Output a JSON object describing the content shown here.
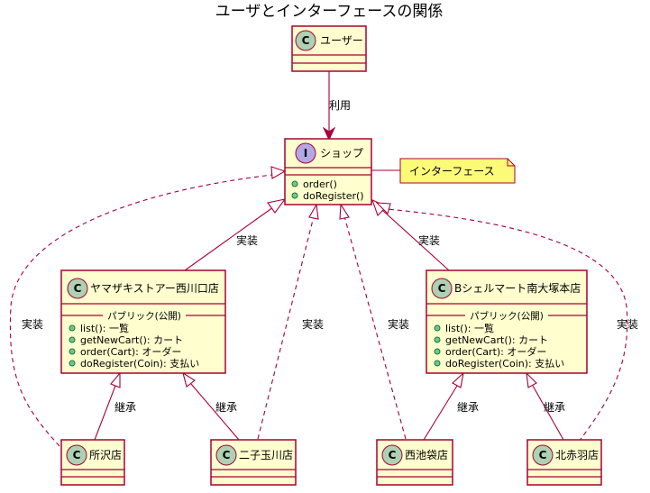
{
  "diagram": {
    "title": "ユーザとインターフェースの関係",
    "classes": {
      "user": {
        "stereotype": "C",
        "name": "ユーザー"
      },
      "shop": {
        "stereotype": "I",
        "name": "ショップ",
        "methods": [
          "order()",
          "doRegister()"
        ]
      },
      "yamazaki": {
        "stereotype": "C",
        "name": "ヤマザキストアー西川口店",
        "section": "パブリック(公開)",
        "methods": [
          "list(): 一覧",
          "getNewCart(): カート",
          "order(Cart): オーダー",
          "doRegister(Coin): 支払い"
        ]
      },
      "bshell": {
        "stereotype": "C",
        "name": "Bシェルマート南大塚本店",
        "section": "パブリック(公開)",
        "methods": [
          "list(): 一覧",
          "getNewCart(): カート",
          "order(Cart): オーダー",
          "doRegister(Coin): 支払い"
        ]
      },
      "tokorozawa": {
        "stereotype": "C",
        "name": "所沢店"
      },
      "futako": {
        "stereotype": "C",
        "name": "二子玉川店"
      },
      "nishiikebukuro": {
        "stereotype": "C",
        "name": "西池袋店"
      },
      "kitaakabane": {
        "stereotype": "C",
        "name": "北赤羽店"
      }
    },
    "note": "インターフェース",
    "edge_labels": {
      "uses": "利用",
      "implements": "実装",
      "inherits": "継承"
    }
  }
}
